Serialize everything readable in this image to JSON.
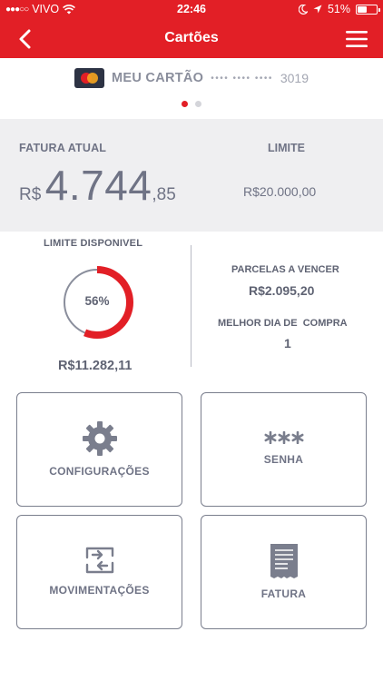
{
  "status_bar": {
    "carrier": "VIVO",
    "time": "22:46",
    "battery": "51%",
    "battery_level": 0.51
  },
  "header": {
    "title": "Cartões",
    "back_icon": "chevron-left-icon",
    "menu_icon": "hamburger-menu-icon"
  },
  "card": {
    "brand_icon": "mastercard-icon",
    "name": "MEU CARTÃO",
    "mask": "•••• •••• ••••",
    "last_digits": "3019",
    "pages": 2,
    "active_page": 1
  },
  "invoice": {
    "label": "FATURA ATUAL",
    "currency": "R$",
    "amount_int": "4.744",
    "amount_dec": ",85",
    "limit_label": "LIMITE",
    "limit_value": "R$20.000,00"
  },
  "available": {
    "label": "LIMITE DISPONIVEL",
    "percent_text": "56%",
    "percent": 56,
    "value": "R$11.282,11"
  },
  "installments": {
    "label": "PARCELAS A VENCER",
    "value": "R$2.095,20",
    "best_day_label": "MELHOR DIA DE  COMPRA",
    "best_day_value": "1"
  },
  "actions": [
    {
      "label": "CONFIGURAÇÕES",
      "icon": "gear-icon"
    },
    {
      "label": "SENHA",
      "icon": "asterisks-icon"
    },
    {
      "label": "MOVIMENTAÇÕES",
      "icon": "transfer-arrows-icon"
    },
    {
      "label": "FATURA",
      "icon": "receipt-icon"
    }
  ],
  "colors": {
    "brand_red": "#e21f26",
    "text_gray": "#6f7385",
    "panel_gray": "#efeff1"
  }
}
